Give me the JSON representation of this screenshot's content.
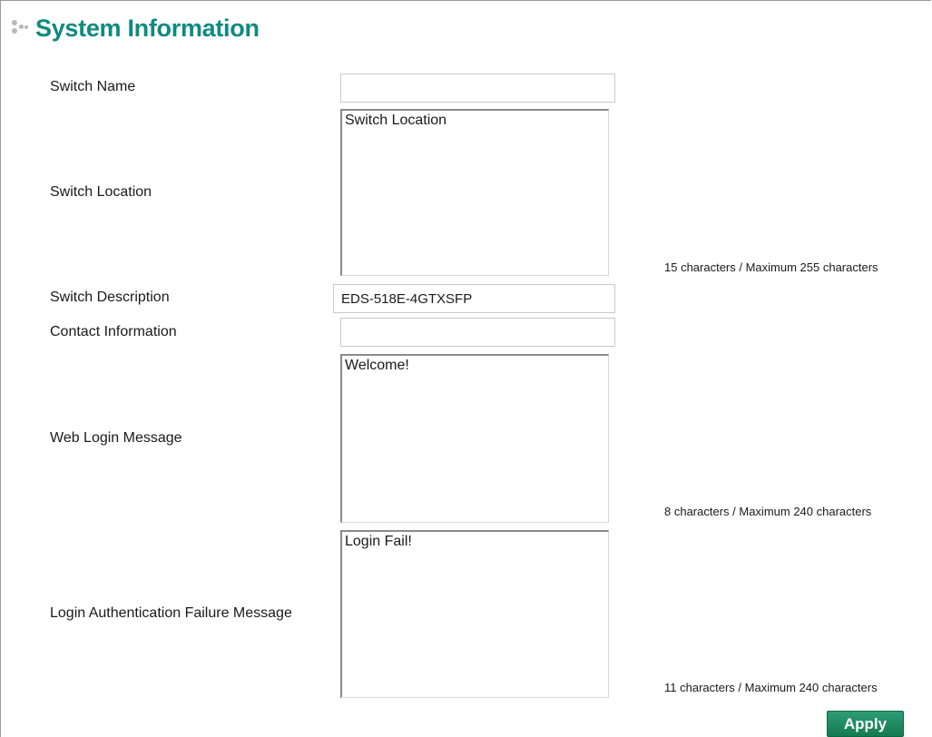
{
  "header": {
    "title": "System Information",
    "icon": "dots-icon"
  },
  "form": {
    "switch_name": {
      "label": "Switch Name",
      "value": ""
    },
    "switch_location": {
      "label": "Switch Location",
      "value": "Switch Location",
      "counter": "15 characters / Maximum 255 characters"
    },
    "switch_description": {
      "label": "Switch Description",
      "value": "EDS-518E-4GTXSFP"
    },
    "contact_information": {
      "label": "Contact Information",
      "value": ""
    },
    "web_login_message": {
      "label": "Web Login Message",
      "value": "Welcome!",
      "counter": "8 characters / Maximum 240 characters"
    },
    "login_failure_message": {
      "label": "Login Authentication Failure Message",
      "value": "Login Fail!",
      "counter": "11 characters / Maximum 240 characters"
    }
  },
  "actions": {
    "apply_label": "Apply"
  },
  "colors": {
    "title": "#0f8a80",
    "apply_button": "#1d8a5e"
  }
}
